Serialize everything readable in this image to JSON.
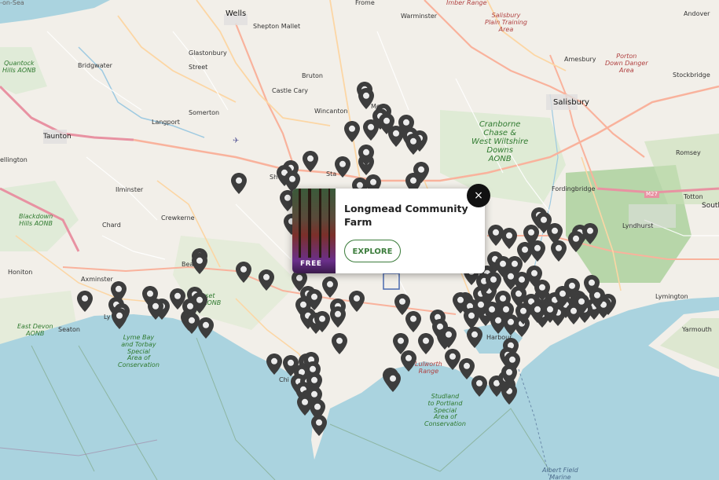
{
  "popup": {
    "title": "Longmead Community Farm",
    "badge": "FREE",
    "button_label": "EXPLORE",
    "close_symbol": "×"
  },
  "map_labels": {
    "wells": "Wells",
    "frome": "Frome",
    "warminster": "Warminster",
    "andover": "Andover",
    "shepton_mallet": "Shepton Mallet",
    "glastonbury": "Glastonbury",
    "bridgwater": "Bridgwater",
    "street": "Street",
    "bruton": "Bruton",
    "castle_cary": "Castle Cary",
    "wincanton": "Wincanton",
    "mere": "Mere",
    "amesbury": "Amesbury",
    "stockbridge": "Stockbridge",
    "salisbury": "Salisbury",
    "somerton": "Somerton",
    "langport": "Langport",
    "taunton": "Taunton",
    "ilminster": "Ilminster",
    "crewkerne": "Crewkerne",
    "chard": "Chard",
    "honiton": "Honiton",
    "axminster": "Axminster",
    "seaton": "Seaton",
    "fordingbridge": "Fordingbridge",
    "lyndhurst": "Lyndhurst",
    "totton": "Totton",
    "lymington": "Lymington",
    "yarmouth": "Yarmouth",
    "romsey": "Romsey",
    "m27": "M27",
    "south_edge": "South",
    "wellington_partial": "ellington",
    "beaminster_partial": "Bea",
    "stalbridge_partial": "Sta",
    "lyme_partial": "Ly",
    "chickerell_partial": "Chi",
    "harbour_partial": "Harbour",
    "sherborne_partial": "Sh",
    "dorset_aonb_partial": "rset\nAONB",
    "cranborne": "Cranborne\nChase &\nWest Wiltshire\nDowns\nAONB",
    "blackdown": "Blackdown\nHills AONB",
    "quantock": "Quantock\nHills AONB",
    "east_devon": "East Devon\nAONB",
    "lyme_bay": "Lyme Bay\nand Torbay\nSpecial\nArea of\nConservation",
    "studland": "Studland\nto Portland\nSpecial\nArea of\nConservation",
    "lulworth": "Lulworth\nRange",
    "salisbury_plain": "Salisbury\nPlain Training\nArea",
    "imber": "Imber Range",
    "porton": "Porton\nDown Danger\nArea",
    "albert_field": "Albert Field\nMarine",
    "top_left_partial": "-on-Sea"
  },
  "colors": {
    "land": "#f2efe9",
    "sea": "#aad3df",
    "forest": "#add19e",
    "motorway": "#e892a2",
    "trunk": "#f9b29c",
    "primary": "#fcd6a4",
    "marker": "#3d3d3d",
    "explore": "#3c7d3c"
  },
  "icons": {
    "marker": "map-pin-icon",
    "close": "close-icon"
  }
}
